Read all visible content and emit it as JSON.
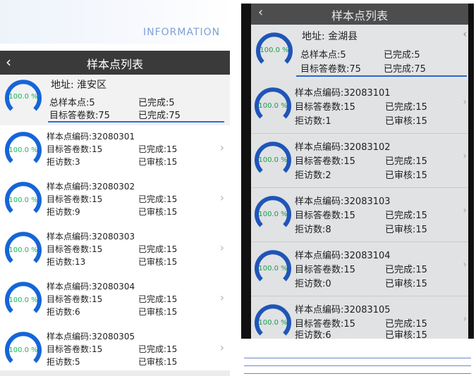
{
  "header": {
    "info_word": "INFORMATION"
  },
  "left": {
    "back_icon": "‹",
    "title": "样本点列表",
    "summary": {
      "gauge": "100.0 %",
      "address": "地址: 淮安区",
      "total": "总样本点:5",
      "done": "已完成:5",
      "target": "目标答卷数:75",
      "done2": "已完成:75"
    },
    "items": [
      {
        "gauge": "100.0 %",
        "code": "样本点编码:32080301",
        "target": "目标答卷数:15",
        "done": "已完成:15",
        "refused": "拒访数:3",
        "reviewed": "已审核:15"
      },
      {
        "gauge": "100.0 %",
        "code": "样本点编码:32080302",
        "target": "目标答卷数:15",
        "done": "已完成:15",
        "refused": "拒访数:9",
        "reviewed": "已审核:15"
      },
      {
        "gauge": "100.0 %",
        "code": "样本点编码:32080303",
        "target": "目标答卷数:15",
        "done": "已完成:15",
        "refused": "拒访数:13",
        "reviewed": "已审核:15"
      },
      {
        "gauge": "100.0 %",
        "code": "样本点编码:32080304",
        "target": "目标答卷数:15",
        "done": "已完成:15",
        "refused": "拒访数:6",
        "reviewed": "已审核:15"
      },
      {
        "gauge": "100.0 %",
        "code": "样本点编码:32080305",
        "target": "目标答卷数:15",
        "done": "已完成:15",
        "refused": "拒访数:5",
        "reviewed": "已审核:15"
      }
    ],
    "chevron": "›"
  },
  "right": {
    "back_icon": "‹",
    "title": "样本点列表",
    "summary": {
      "gauge": "100.0 %",
      "address": "地址: 金湖县",
      "total": "总样本点:5",
      "done": "已完成:5",
      "target": "目标答卷数:75",
      "done2": "已完成:75"
    },
    "items": [
      {
        "gauge": "100.0 %",
        "code": "样本点编码:32083101",
        "target": "目标答卷数:15",
        "done": "已完成:15",
        "refused": "拒访数:1",
        "reviewed": "已审核:15"
      },
      {
        "gauge": "100.0 %",
        "code": "样本点编码:32083102",
        "target": "目标答卷数:15",
        "done": "已完成:15",
        "refused": "拒访数:2",
        "reviewed": "已审核:15"
      },
      {
        "gauge": "100.0 %",
        "code": "样本点编码:32083103",
        "target": "目标答卷数:15",
        "done": "已完成:15",
        "refused": "拒访数:8",
        "reviewed": "已审核:15"
      },
      {
        "gauge": "100.0 %",
        "code": "样本点编码:32083104",
        "target": "目标答卷数:15",
        "done": "已完成:15",
        "refused": "拒访数:0",
        "reviewed": "已审核:15"
      },
      {
        "gauge": "100.0 %",
        "code": "样本点编码:32083105",
        "target": "目标答卷数:15",
        "done": "已完成:15",
        "refused": "拒访数:6",
        "reviewed": "已审核:15"
      }
    ],
    "chevron": "›"
  },
  "colors": {
    "accent": "#1565d8",
    "gauge_text": "#19b35a",
    "titlebar": "#3a3a3a"
  },
  "icons": {
    "back": "chevron-left-icon",
    "row": "chevron-right-icon",
    "gauge": "progress-gauge-icon"
  }
}
